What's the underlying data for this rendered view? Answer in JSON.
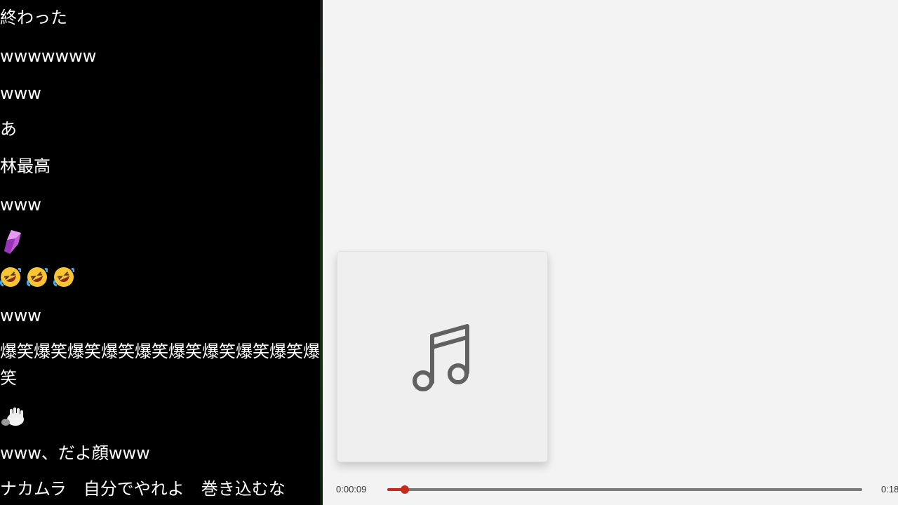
{
  "chat": {
    "messages": [
      "終わった",
      "wwwwwww",
      "www",
      "あ",
      "林最高",
      "www",
      "www",
      "爆笑爆笑爆笑爆笑爆笑爆笑爆笑爆笑爆笑爆笑",
      "www、だよ顔www",
      "ナカムラ　自分でやれよ　巻き込むな"
    ],
    "emoji": {
      "gem": "purple-crystal-icon",
      "rofl": "rolling-on-floor-laughing-icon",
      "hand": "waving-hand-icon"
    }
  },
  "player": {
    "time_current": "0:00:09",
    "time_total": "0:18",
    "progress": 0.02,
    "accent_color": "#c42b1c",
    "album_icon": "music-note-icon"
  }
}
